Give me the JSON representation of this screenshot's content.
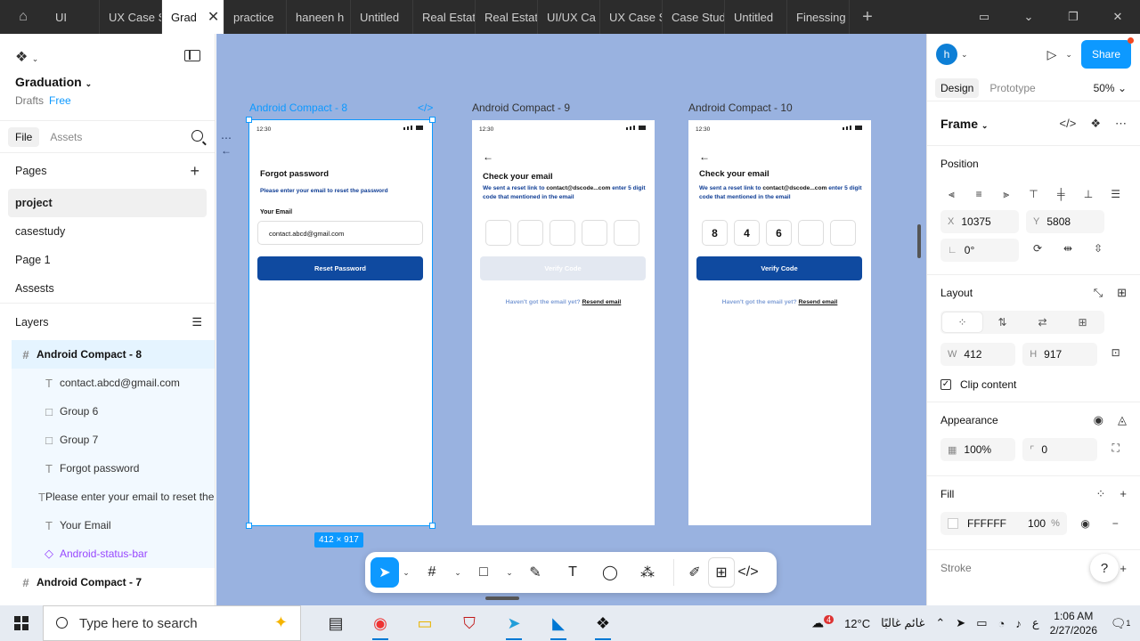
{
  "tabs": [
    {
      "label": "UI",
      "width": 60
    },
    {
      "label": "UX Case S",
      "width": 70
    },
    {
      "label": "Grad",
      "width": 70,
      "active": true
    },
    {
      "label": "practice",
      "width": 70
    },
    {
      "label": "haneen h",
      "width": 72
    },
    {
      "label": "Untitled",
      "width": 70
    },
    {
      "label": "Real Estat",
      "width": 70
    },
    {
      "label": "Real Estat",
      "width": 70
    },
    {
      "label": "UI/UX Ca",
      "width": 70
    },
    {
      "label": "UX Case S",
      "width": 70
    },
    {
      "label": "Case Stud",
      "width": 70
    },
    {
      "label": "Untitled",
      "width": 70
    },
    {
      "label": "Finessing",
      "width": 70
    }
  ],
  "project": {
    "name": "Graduation",
    "location": "Drafts",
    "plan": "Free"
  },
  "left_tabs": {
    "file": "File",
    "assets": "Assets"
  },
  "pages": {
    "heading": "Pages",
    "items": [
      "project",
      "casestudy",
      "Page 1",
      "Assests"
    ]
  },
  "layers": {
    "heading": "Layers",
    "selected_frame": "Android Compact - 8",
    "children": [
      {
        "name": "contact.abcd@gmail.com",
        "icon": "T"
      },
      {
        "name": "Group 6",
        "icon": "□"
      },
      {
        "name": "Group 7",
        "icon": "□"
      },
      {
        "name": "Forgot password",
        "icon": "T"
      },
      {
        "name": "Please enter your email to reset the password",
        "icon": "T"
      },
      {
        "name": "Your Email",
        "icon": "T"
      },
      {
        "name": "Android-status-bar",
        "icon": "◇"
      }
    ],
    "next_frame": "Android Compact - 7"
  },
  "canvas": {
    "bg_color": "#99b2e0",
    "size_badge": "412 × 917",
    "frames": [
      {
        "label": "Android Compact - 8",
        "time": "12:30",
        "title": "Forgot password",
        "description": "Please enter your email to reset the password",
        "email_label": "Your Email",
        "email_value": "contact.abcd@gmail.com",
        "button": "Reset Password"
      },
      {
        "label": "Android Compact - 9",
        "time": "12:30",
        "title": "Check your email",
        "desc_prefix": "We sent a reset link to ",
        "desc_email": "contact@dscode...com",
        "desc_suffix": " enter 5 digit code that mentioned in the email",
        "otp": [
          "",
          "",
          "",
          "",
          ""
        ],
        "button": "Verify Code",
        "resend_prefix": "Haven't got the email yet? ",
        "resend_link": "Resend email"
      },
      {
        "label": "Android Compact - 10",
        "time": "12:30",
        "title": "Check your email",
        "desc_prefix": "We sent a reset link to ",
        "desc_email": "contact@dscode...com",
        "desc_suffix": " enter 5 digit code that mentioned in the email",
        "otp": [
          "8",
          "4",
          "6",
          "",
          ""
        ],
        "button": "Verify Code",
        "resend_prefix": "Haven't got the email yet? ",
        "resend_link": "Resend email"
      }
    ]
  },
  "toolbar": {
    "move": "move-tool",
    "frame": "frame-tool",
    "shape": "rectangle-tool",
    "pen": "pen-tool",
    "text": "text-tool",
    "comment": "comment-tool",
    "actions": "actions-tool"
  },
  "right": {
    "avatar_letter": "h",
    "share": "Share",
    "tab_design": "Design",
    "tab_prototype": "Prototype",
    "zoom": "50%",
    "frame_title": "Frame",
    "position": {
      "heading": "Position",
      "x_label": "X",
      "x": "10375",
      "y_label": "Y",
      "y": "5808",
      "rotation": "0°"
    },
    "layout": {
      "heading": "Layout",
      "w_label": "W",
      "w": "412",
      "h_label": "H",
      "h": "917",
      "clip": "Clip content"
    },
    "appearance": {
      "heading": "Appearance",
      "opacity": "100%",
      "radius": "0"
    },
    "fill": {
      "heading": "Fill",
      "hex": "FFFFFF",
      "opacity": "100",
      "unit": "%"
    },
    "stroke": {
      "heading": "Stroke"
    },
    "help": "?"
  },
  "taskbar": {
    "search_placeholder": "Type here to search",
    "weather_temp": "12°C",
    "weather_text": "غائم غالبًا",
    "weather_badge": "4",
    "lang": "ع",
    "time": "1:06 AM",
    "date": "2/27/2026",
    "notif_count": "1"
  }
}
